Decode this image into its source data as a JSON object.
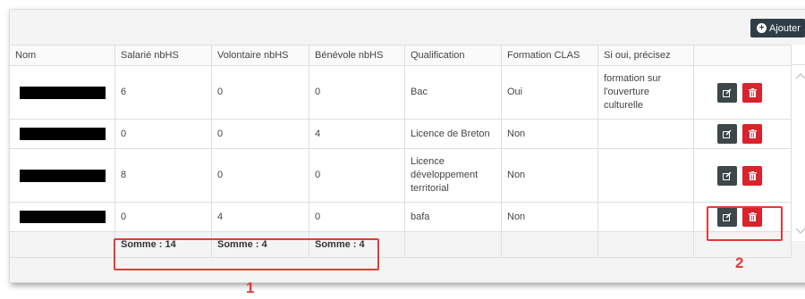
{
  "toolbar": {
    "add_label": "Ajouter",
    "add_icon": "plus-circle-icon"
  },
  "table": {
    "headers": [
      "Nom",
      "Salarié nbHS",
      "Volontaire nbHS",
      "Bénévole nbHS",
      "Qualification",
      "Formation CLAS",
      "Si oui, précisez",
      ""
    ],
    "rows": [
      {
        "name": "",
        "salarie": "6",
        "volontaire": "0",
        "benevole": "0",
        "qualification": "Bac",
        "formation_clas": "Oui",
        "precisez": "formation sur l'ouverture culturelle"
      },
      {
        "name": "",
        "salarie": "0",
        "volontaire": "0",
        "benevole": "4",
        "qualification": "Licence de Breton",
        "formation_clas": "Non",
        "precisez": ""
      },
      {
        "name": "",
        "salarie": "8",
        "volontaire": "0",
        "benevole": "0",
        "qualification": "Licence développement territorial",
        "formation_clas": "Non",
        "precisez": ""
      },
      {
        "name": "",
        "salarie": "0",
        "volontaire": "4",
        "benevole": "0",
        "qualification": "bafa",
        "formation_clas": "Non",
        "precisez": ""
      }
    ],
    "footer": {
      "salarie": "Somme : 14",
      "volontaire": "Somme : 4",
      "benevole": "Somme : 4"
    }
  },
  "annotations": {
    "label_1": "1",
    "label_2": "2",
    "color": "#e53935"
  },
  "colors": {
    "edit_button": "#3d4649",
    "delete_button": "#d9232d",
    "add_button": "#2f3e46"
  },
  "row_actions": {
    "edit_icon": "edit-icon",
    "delete_icon": "trash-icon"
  }
}
